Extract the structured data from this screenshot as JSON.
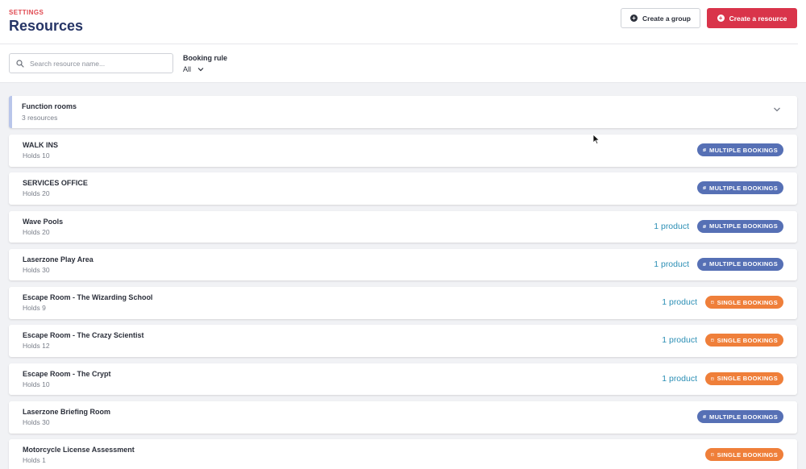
{
  "header": {
    "eyebrow": "SETTINGS",
    "title": "Resources",
    "create_group_label": "Create a group",
    "create_resource_label": "Create a resource"
  },
  "filters": {
    "search_placeholder": "Search resource name...",
    "booking_rule_label": "Booking rule",
    "booking_rule_value": "All"
  },
  "group": {
    "name": "Function rooms",
    "count_label": "3 resources"
  },
  "badges": {
    "multiple": "MULTIPLE BOOKINGS",
    "single": "SINGLE BOOKINGS"
  },
  "colors": {
    "accent_red": "#d9344a",
    "title_navy": "#263566",
    "multiple_badge": "#5670b5",
    "single_badge": "#ef7f3a",
    "product_link": "#2c8fb5"
  },
  "resources": [
    {
      "name": "WALK INS",
      "holds": "Holds 10",
      "products": "",
      "booking": "multiple"
    },
    {
      "name": "SERVICES OFFICE",
      "holds": "Holds 20",
      "products": "",
      "booking": "multiple"
    },
    {
      "name": "Wave Pools",
      "holds": "Holds 20",
      "products": "1 product",
      "booking": "multiple"
    },
    {
      "name": "Laserzone Play Area",
      "holds": "Holds 30",
      "products": "1 product",
      "booking": "multiple"
    },
    {
      "name": "Escape Room - The Wizarding School",
      "holds": "Holds 9",
      "products": "1 product",
      "booking": "single"
    },
    {
      "name": "Escape Room - The Crazy Scientist",
      "holds": "Holds 12",
      "products": "1 product",
      "booking": "single"
    },
    {
      "name": "Escape Room - The Crypt",
      "holds": "Holds 10",
      "products": "1 product",
      "booking": "single"
    },
    {
      "name": "Laserzone Briefing Room",
      "holds": "Holds 30",
      "products": "",
      "booking": "multiple"
    },
    {
      "name": "Motorcycle License Assessment",
      "holds": "Holds 1",
      "products": "",
      "booking": "single"
    }
  ]
}
